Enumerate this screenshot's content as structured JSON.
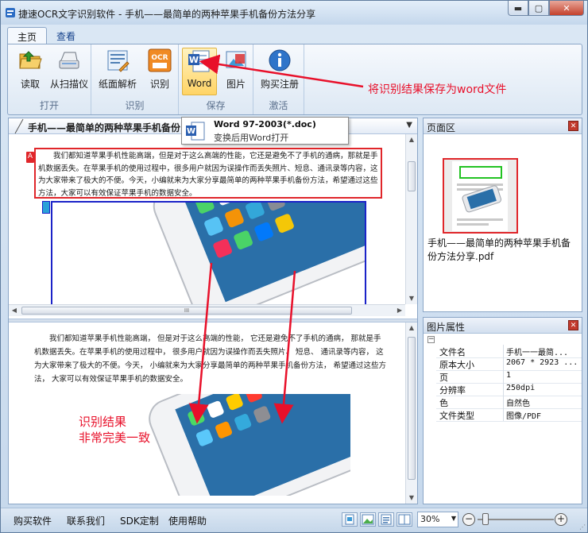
{
  "window": {
    "title": "捷速OCR文字识别软件 - 手机——最简单的两种苹果手机备份方法分享",
    "min": "▬",
    "max": "▢",
    "close": "✕"
  },
  "ribbon": {
    "tabs": [
      {
        "label": "主页"
      },
      {
        "label": "查看"
      }
    ],
    "groups": {
      "open": {
        "label": "打开",
        "read": "读取",
        "scan": "从扫描仪"
      },
      "recognize": {
        "label": "识别",
        "parse": "纸面解析",
        "recog": "识别"
      },
      "save": {
        "label": "保存",
        "word": "Word",
        "pic": "图片"
      },
      "activate": {
        "label": "激活",
        "buy": "购买注册"
      }
    }
  },
  "tooltip": {
    "line1": "Word 97-2003(*.doc)",
    "line2": "变换后用Word打开"
  },
  "annotations": {
    "save_note": "将识别结果保存为word文件",
    "result_note_1": "识别结果",
    "result_note_2": "非常完美一致"
  },
  "document": {
    "title": "手机——最简单的两种苹果手机备份",
    "source_paragraph": "我们都知道苹果手机性能高端，但是对于这么高端的性能，它还是避免不了手机的通病，那就是手机数据丢失。在苹果手机的使用过程中，很多用户就因为误操作而丢失照片、短息、通讯录等内容，这为大家带来了极大的不便。今天，小编就来为大家分享最简单的两种苹果手机备份方法，希望通过这些方法，大家可以有效保证苹果手机的数据安全。",
    "result_paragraph": "我们都知道苹果手机性能高端， 但是对于这么高端的性能， 它还是避免不了手机的通病， 那就是手机数据丢失。在苹果手机的使用过程中， 很多用户就因为误操作而丢失照片、 短息、 通讯录等内容， 这为大家带来了极大的不便。今天， 小编就来为大家分享最简单的两种苹果手机备份方法， 希望通过这些方法， 大家可以有效保证苹果手机的数据安全。",
    "hscroll_grip": "III"
  },
  "pages_pane": {
    "title": "页面区",
    "close": "✕",
    "filename": "手机——最简单的两种苹果手机备份方法分享.pdf"
  },
  "props_pane": {
    "title": "图片属性",
    "close": "✕",
    "collapse": "−",
    "rows": [
      {
        "key": "文件名",
        "value": "手机一一最简..."
      },
      {
        "key": "原本大小",
        "value": "2067 * 2923 ..."
      },
      {
        "key": "页",
        "value": "1"
      },
      {
        "key": "分辨率",
        "value": "250dpi"
      },
      {
        "key": "色",
        "value": "自然色"
      },
      {
        "key": "文件类型",
        "value": "图像/PDF"
      }
    ]
  },
  "statusbar": {
    "links": [
      {
        "label": "购买软件"
      },
      {
        "label": "联系我们"
      },
      {
        "label": "SDK定制"
      },
      {
        "label": "使用帮助"
      }
    ],
    "zoom": "30%",
    "zoom_minus": "−",
    "zoom_plus": "+",
    "zoom_level": 0.1
  },
  "colors": {
    "accent_red": "#e8102a",
    "selection_blue": "#1b23c8",
    "ribbon_active": "#ffd466"
  },
  "icons": [
    "folder-open-icon",
    "scanner-icon",
    "paper-parse-icon",
    "ocr-icon",
    "word-doc-icon",
    "picture-icon",
    "info-icon"
  ]
}
